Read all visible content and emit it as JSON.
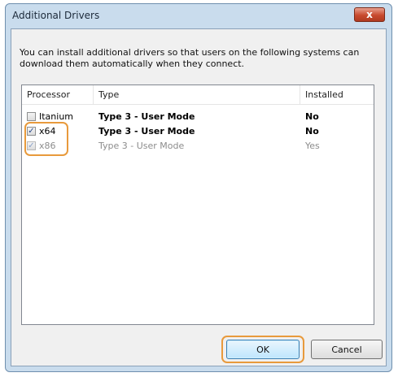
{
  "window": {
    "title": "Additional Drivers",
    "close_label": "x"
  },
  "description": "You can install additional drivers so that users on the following systems can download them automatically when they connect.",
  "table": {
    "columns": [
      "Processor",
      "Type",
      "Installed"
    ],
    "rows": [
      {
        "processor": "Itanium",
        "type": "Type 3 - User Mode",
        "installed": "No",
        "checked": false,
        "disabled": false
      },
      {
        "processor": "x64",
        "type": "Type 3 - User Mode",
        "installed": "No",
        "checked": true,
        "disabled": false
      },
      {
        "processor": "x86",
        "type": "Type 3 - User Mode",
        "installed": "Yes",
        "checked": true,
        "disabled": true
      }
    ]
  },
  "buttons": {
    "ok": "OK",
    "cancel": "Cancel"
  },
  "colors": {
    "highlight": "#e89a3c",
    "close_button": "#c84a2e"
  }
}
